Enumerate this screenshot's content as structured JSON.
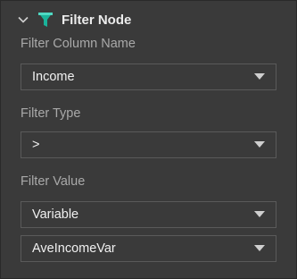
{
  "header": {
    "title": "Filter Node",
    "collapse_icon": "chevron-down-icon",
    "node_icon": "funnel-icon",
    "accent": "#1ab39a"
  },
  "fields": {
    "column": {
      "label": "Filter Column Name",
      "value": "Income"
    },
    "type": {
      "label": "Filter Type",
      "value": ">"
    },
    "value": {
      "label": "Filter Value",
      "mode": "Variable",
      "variable": "AveIncomeVar"
    }
  }
}
